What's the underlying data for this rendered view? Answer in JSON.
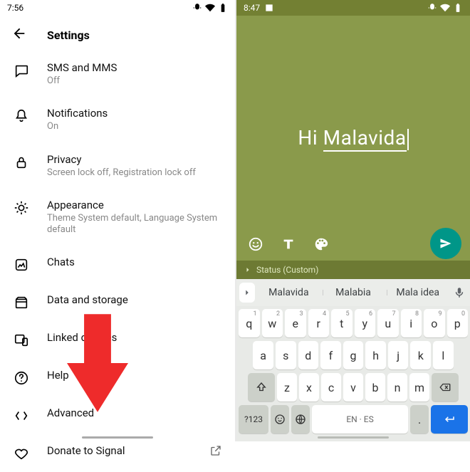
{
  "left": {
    "time": "7:56",
    "header": "Settings",
    "items": [
      {
        "key": "sms",
        "title": "SMS and MMS",
        "sub": "Off"
      },
      {
        "key": "notifications",
        "title": "Notifications",
        "sub": "On"
      },
      {
        "key": "privacy",
        "title": "Privacy",
        "sub": "Screen lock off, Registration lock off"
      },
      {
        "key": "appearance",
        "title": "Appearance",
        "sub": "Theme System default, Language System default"
      },
      {
        "key": "chats",
        "title": "Chats",
        "sub": ""
      },
      {
        "key": "data",
        "title": "Data and storage",
        "sub": ""
      },
      {
        "key": "linked",
        "title": "Linked devices",
        "sub": ""
      },
      {
        "key": "help",
        "title": "Help",
        "sub": ""
      },
      {
        "key": "advanced",
        "title": "Advanced",
        "sub": ""
      },
      {
        "key": "donate",
        "title": "Donate to Signal",
        "sub": ""
      }
    ]
  },
  "right": {
    "time": "8:47",
    "compose_prefix": "Hi ",
    "compose_word": "Malavida",
    "status_label": "Status (Custom)",
    "suggestions": [
      "Malavida",
      "Malabia",
      "Mala idea"
    ],
    "keyboard": {
      "row1": [
        "q",
        "w",
        "e",
        "r",
        "t",
        "y",
        "u",
        "i",
        "o",
        "p"
      ],
      "row1_sup": [
        "1",
        "2",
        "3",
        "4",
        "5",
        "6",
        "7",
        "8",
        "9",
        "0"
      ],
      "row2": [
        "a",
        "s",
        "d",
        "f",
        "g",
        "h",
        "j",
        "k",
        "l"
      ],
      "row3": [
        "z",
        "x",
        "c",
        "v",
        "b",
        "n",
        "m"
      ],
      "n123": "?123",
      "space": "EN · ES",
      "comma": ",",
      "dot": "."
    }
  }
}
